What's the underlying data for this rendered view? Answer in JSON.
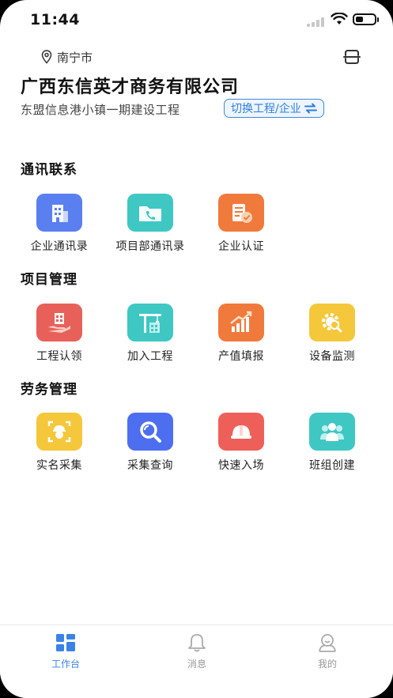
{
  "status_bar": {
    "time": "11:44"
  },
  "header": {
    "location": "南宁市",
    "company": "广西东信英才商务有限公司",
    "project": "东盟信息港小镇一期建设工程",
    "switch_label": "切换工程/企业"
  },
  "sections": [
    {
      "title": "通讯联系",
      "items": [
        {
          "label": "企业通讯录",
          "icon": "building-contacts-icon",
          "color": "#5a7ff0"
        },
        {
          "label": "项目部通讯录",
          "icon": "phone-folder-icon",
          "color": "#3ec7c3"
        },
        {
          "label": "企业认证",
          "icon": "certificate-icon",
          "color": "#f07a3c"
        }
      ]
    },
    {
      "title": "项目管理",
      "items": [
        {
          "label": "工程认领",
          "icon": "hand-building-icon",
          "color": "#e8605a"
        },
        {
          "label": "加入工程",
          "icon": "crane-icon",
          "color": "#3ec7c3"
        },
        {
          "label": "产值填报",
          "icon": "growth-chart-icon",
          "color": "#f07a3c"
        },
        {
          "label": "设备监测",
          "icon": "gear-search-icon",
          "color": "#f5c73a"
        }
      ]
    },
    {
      "title": "劳务管理",
      "items": [
        {
          "label": "实名采集",
          "icon": "face-scan-icon",
          "color": "#f5c73a"
        },
        {
          "label": "采集查询",
          "icon": "magnifier-icon",
          "color": "#4e6ef0"
        },
        {
          "label": "快速入场",
          "icon": "helmet-icon",
          "color": "#ee5f5a"
        },
        {
          "label": "班组创建",
          "icon": "team-icon",
          "color": "#3ec7c3"
        }
      ]
    }
  ],
  "tabbar": {
    "tabs": [
      {
        "label": "工作台",
        "icon": "grid-icon",
        "active": true
      },
      {
        "label": "消息",
        "icon": "bell-icon",
        "active": false
      },
      {
        "label": "我的",
        "icon": "profile-icon",
        "active": false
      }
    ],
    "active_color": "#3b82e6",
    "inactive_color": "#999999"
  }
}
